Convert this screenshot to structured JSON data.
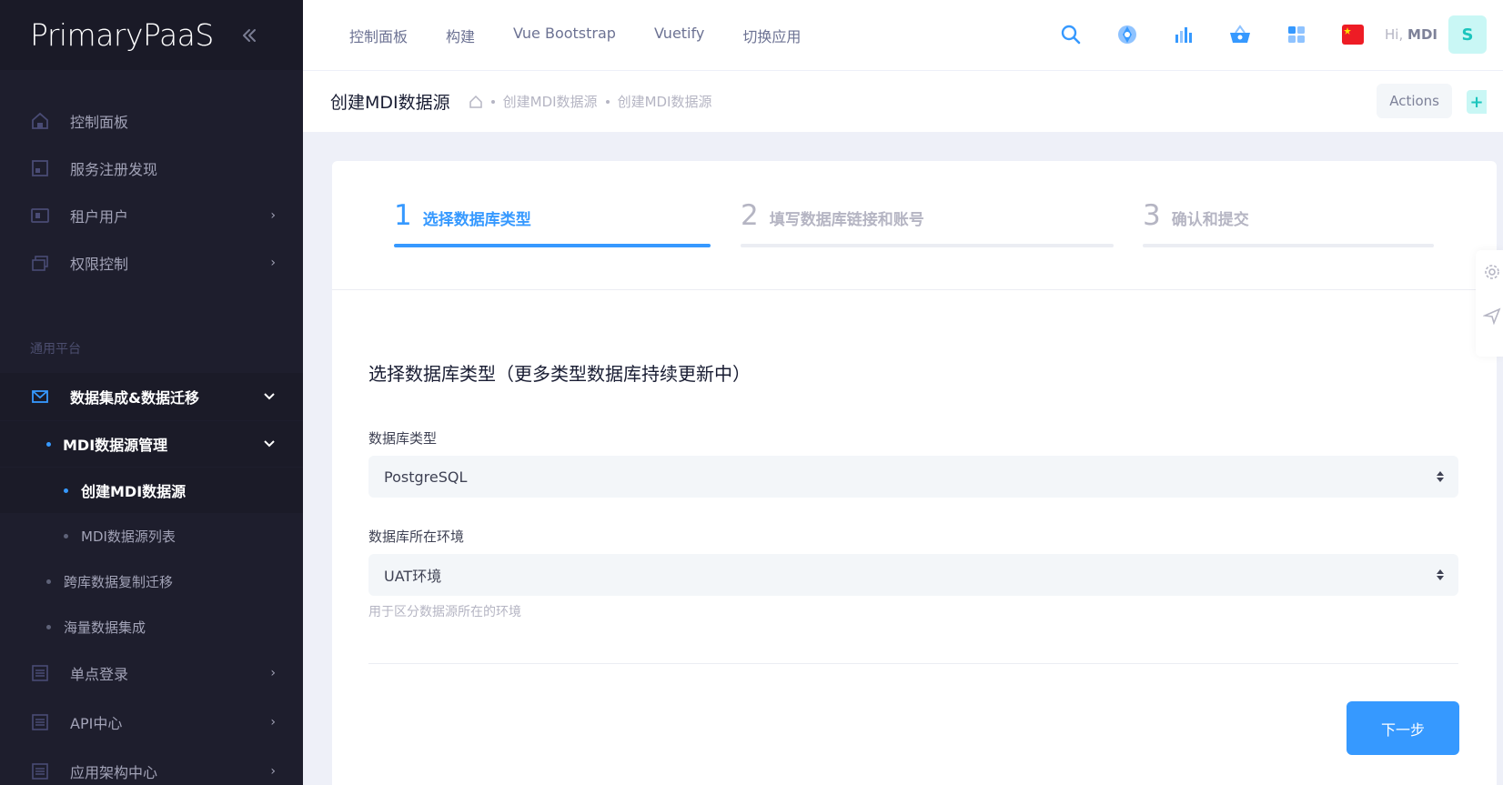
{
  "brand": {
    "logo": "PrimaryPaaS",
    "toggle_icon": "double-chevron-left"
  },
  "sidebar": {
    "items": [
      {
        "label": "控制面板",
        "icon": "home-icon"
      },
      {
        "label": "服务注册发现",
        "icon": "layout-icon"
      },
      {
        "label": "租户用户",
        "icon": "users-icon"
      },
      {
        "label": "权限控制",
        "icon": "layers-icon"
      }
    ],
    "section_title": "通用平台",
    "data_group": {
      "label": "数据集成&数据迁移",
      "icon": "mail-icon"
    },
    "mdi_group": {
      "label": "MDI数据源管理"
    },
    "mdi_create": {
      "label": "创建MDI数据源"
    },
    "mdi_list": {
      "label": "MDI数据源列表"
    },
    "cross_copy": {
      "label": "跨库数据复制迁移"
    },
    "mass_data": {
      "label": "海量数据集成"
    },
    "sso": {
      "label": "单点登录"
    },
    "api": {
      "label": "API中心"
    },
    "arch": {
      "label": "应用架构中心"
    }
  },
  "header": {
    "nav": [
      "控制面板",
      "构建",
      "Vue Bootstrap",
      "Vuetify",
      "切换应用"
    ],
    "greeting_prefix": "Hi,",
    "user": "MDI",
    "avatar_letter": "S"
  },
  "subheader": {
    "title": "创建MDI数据源",
    "breadcrumb": [
      "创建MDI数据源",
      "创建MDI数据源"
    ],
    "actions_label": "Actions",
    "plus_label": "+"
  },
  "wizard": {
    "steps": [
      {
        "num": "1",
        "label": "选择数据库类型"
      },
      {
        "num": "2",
        "label": "填写数据库链接和账号"
      },
      {
        "num": "3",
        "label": "确认和提交"
      }
    ],
    "current_step": 1
  },
  "form": {
    "title": "选择数据库类型（更多类型数据库持续更新中）",
    "db_type_label": "数据库类型",
    "db_type_value": "PostgreSQL",
    "env_label": "数据库所在环境",
    "env_value": "UAT环境",
    "env_hint": "用于区分数据源所在的环境",
    "next_button": "下一步"
  },
  "colors": {
    "primary": "#3699ff",
    "sidebar_bg": "#1e1e2d",
    "accent_teal": "#1bc5bd"
  }
}
